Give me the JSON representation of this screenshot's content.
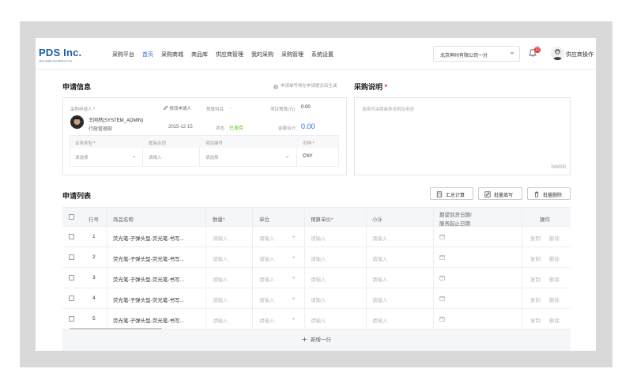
{
  "header": {
    "logo_name": "PDS Inc.",
    "logo_tagline": "value quality and efficiency time",
    "nav": [
      "采购平台",
      "首页",
      "采购商城",
      "商品库",
      "供应商管理",
      "我的采购",
      "采购管理",
      "系统设置"
    ],
    "nav_active": "首页",
    "company": "北京神州有限公司一分",
    "notification_count": "12",
    "user_name": "供应商操作"
  },
  "apply_info": {
    "title": "申请信息",
    "hint": "申请单号将在申请提交后生成",
    "applicant_label": "采购申请人",
    "change_applicant": "修改申请人",
    "applicant_name": "王同然(SYSTEM_ADMIN)",
    "applicant_dept": "行政管理部",
    "date": "2015-12-15",
    "budget_subject_label": "预算科目",
    "budget_subject_value": "--",
    "project_budget_label": "项目预算(元)",
    "project_budget_value": "0.00",
    "status_label": "状态",
    "status_value": "已保存",
    "amount_total_label": "金额合计",
    "amount_total_value": "0.00",
    "fields": {
      "biz_type_label": "业务类型",
      "biz_type_placeholder": "请选择",
      "contract_label": "框架合同",
      "contract_placeholder": "请输入",
      "project_no_label": "项目编号",
      "project_no_placeholder": "请选择",
      "currency_label": "币种",
      "currency_value": "CNY"
    }
  },
  "purchase_note": {
    "title": "采购说明",
    "placeholder": "请填写采购具体说明及用途",
    "counter": "0/4000"
  },
  "list": {
    "title": "申请列表",
    "btn_sum": "汇总计算",
    "btn_batch_fill": "批量填写",
    "btn_batch_delete": "批量删除",
    "columns": {
      "no": "行号",
      "name": "商品名称",
      "qty": "数量",
      "unit": "单位",
      "price": "预算单价",
      "subtotal": "小计",
      "date_line1": "期望到货日期/",
      "date_line2": "服务起止日期",
      "ops": "操作"
    },
    "rows": [
      {
        "no": "1",
        "name": "荧光笔-子弹头型-荧光笔-书写...",
        "qty": "请输入",
        "unit": "请输入",
        "price": "请输入",
        "subtotal": "请输入",
        "copy": "复制",
        "delete": "删除"
      },
      {
        "no": "2",
        "name": "荧光笔-子弹头型-荧光笔-书写...",
        "qty": "请输入",
        "unit": "请输入",
        "price": "请输入",
        "subtotal": "请输入",
        "copy": "复制",
        "delete": "删除"
      },
      {
        "no": "3",
        "name": "荧光笔-子弹头型-荧光笔-书写...",
        "qty": "请输入",
        "unit": "请输入",
        "price": "请输入",
        "subtotal": "请输入",
        "copy": "复制",
        "delete": "删除"
      },
      {
        "no": "4",
        "name": "荧光笔-子弹头型-荧光笔-书写...",
        "qty": "请输入",
        "unit": "请输入",
        "price": "请输入",
        "subtotal": "请输入",
        "copy": "复制",
        "delete": "删除"
      },
      {
        "no": "5",
        "name": "荧光笔-子弹头型-荧光笔-书写...",
        "qty": "请输入",
        "unit": "请输入",
        "price": "请输入",
        "subtotal": "请输入",
        "copy": "复制",
        "delete": "删除"
      }
    ],
    "add_row": "新增一行"
  },
  "colors": {
    "accent": "#2f6fd6",
    "required": "#e53935",
    "saved": "#52c41a",
    "frame": "#d9d9d9"
  }
}
